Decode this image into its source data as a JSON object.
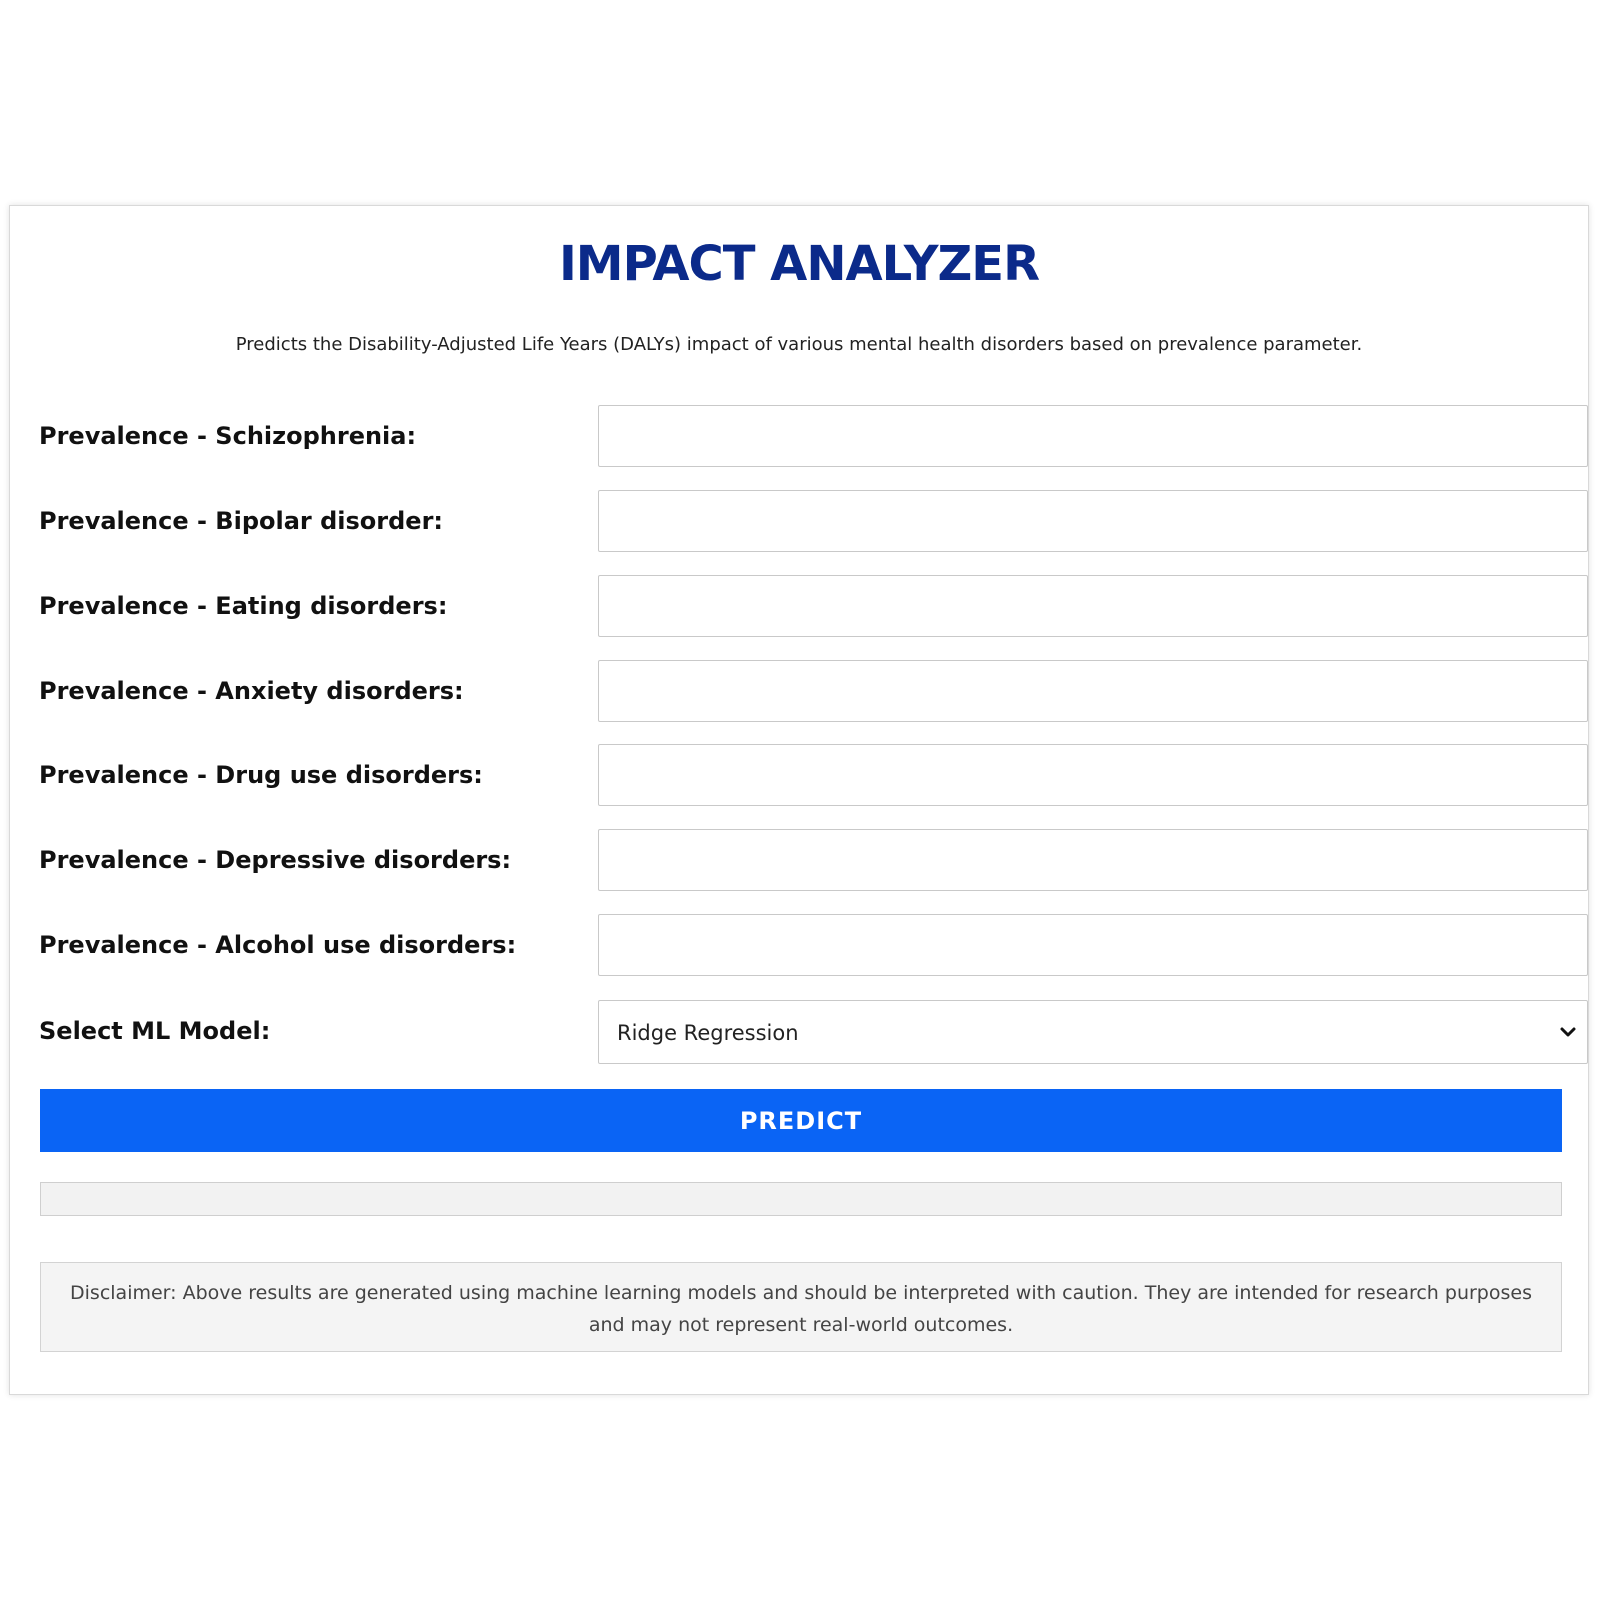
{
  "header": {
    "title": "IMPACT ANALYZER",
    "subtitle": "Predicts the Disability-Adjusted Life Years (DALYs) impact of various mental health disorders based on prevalence parameter."
  },
  "form": {
    "fields": [
      {
        "label": "Prevalence - Schizophrenia:",
        "value": ""
      },
      {
        "label": "Prevalence - Bipolar disorder:",
        "value": ""
      },
      {
        "label": "Prevalence - Eating disorders:",
        "value": ""
      },
      {
        "label": "Prevalence - Anxiety disorders:",
        "value": ""
      },
      {
        "label": "Prevalence - Drug use disorders:",
        "value": ""
      },
      {
        "label": "Prevalence - Depressive disorders:",
        "value": ""
      },
      {
        "label": "Prevalence - Alcohol use disorders:",
        "value": ""
      }
    ],
    "model_select": {
      "label": "Select ML Model:",
      "selected": "Ridge Regression",
      "icon": "chevron-down-icon"
    },
    "predict_label": "PREDICT",
    "result_text": ""
  },
  "disclaimer": {
    "text": "Disclaimer: Above results are generated using machine learning models and should be interpreted with caution. They are intended for research purposes and may not represent real-world outcomes."
  },
  "colors": {
    "title": "#0b2a8a",
    "button": "#0a64f5",
    "button_text": "#ffffff",
    "disclaimer_bg": "#f4f4f4"
  }
}
